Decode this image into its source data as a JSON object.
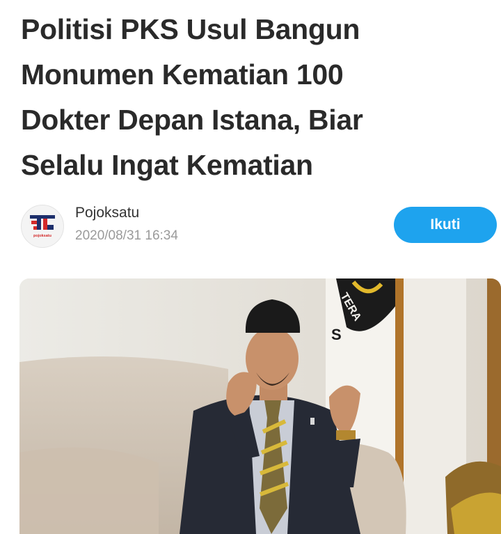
{
  "article": {
    "headline_lines": [
      "Politisi PKS Usul Bangun",
      "Monumen Kematian 100",
      "Dokter Depan Istana, Biar",
      "Selalu Ingat Kematian"
    ]
  },
  "publisher": {
    "name": "Pojoksatu",
    "timestamp": "2020/08/31 16:34",
    "logo_text": "pojoksatu",
    "avatar_icon": "pojoksatu-logo",
    "follow_label": "Ikuti"
  },
  "photo": {
    "flag_text": "TERA",
    "flag_letter": "S"
  },
  "colors": {
    "follow_button": "#1ea3ee",
    "headline": "#2a2a2a",
    "timestamp": "#9a9a9a",
    "logo_red": "#d32a2a",
    "logo_navy": "#1d2f6b"
  }
}
